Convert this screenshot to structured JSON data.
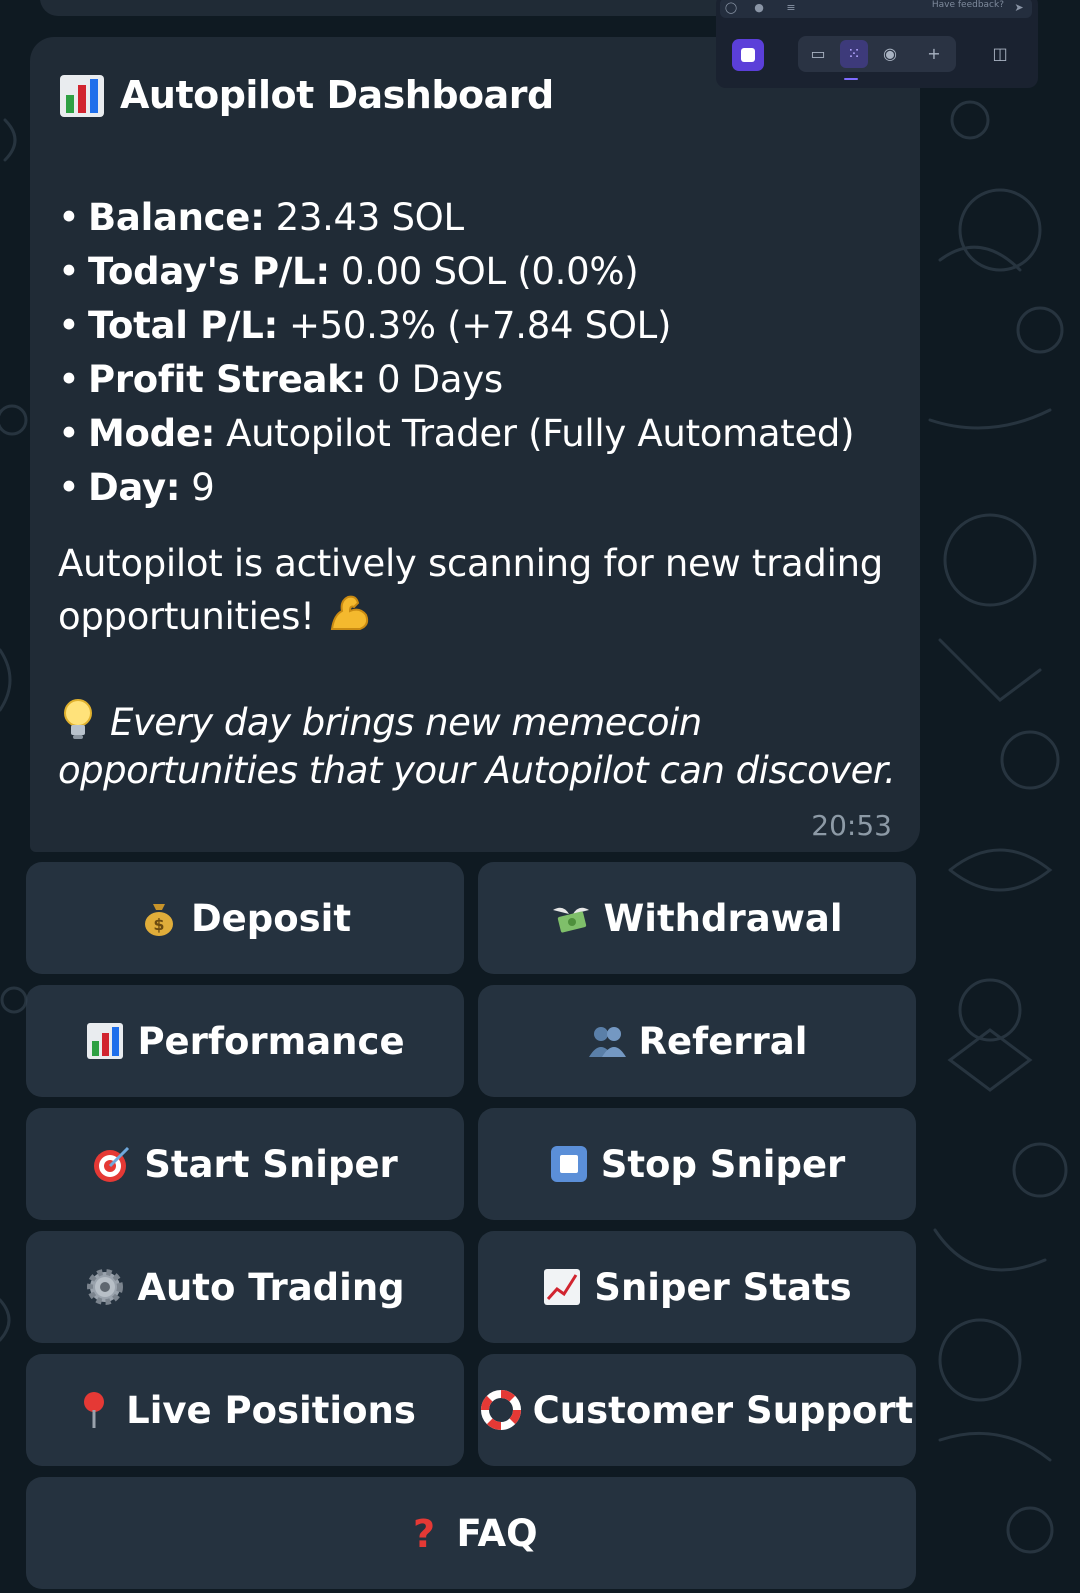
{
  "colors": {
    "background": "#0f1a22",
    "bubble": "#202b36",
    "button": "#2f3c49",
    "timestamp": "#8d9aa6",
    "accent": "#5b3fd9"
  },
  "overlay": {
    "feedback_text": "Have feedback?",
    "icons": [
      "paperclip-icon",
      "microphone-icon",
      "sliders-icon",
      "send-icon",
      "stop-recording-icon",
      "desktop-icon",
      "grid-icon",
      "globe-icon",
      "plus-icon",
      "side-panel-icon"
    ]
  },
  "message": {
    "title_icon": "bar-chart-icon",
    "title": "Autopilot Dashboard",
    "stats": [
      {
        "label": "Balance:",
        "value": "23.43 SOL"
      },
      {
        "label": "Today's P/L:",
        "value": "0.00 SOL (0.0%)"
      },
      {
        "label": "Total P/L:",
        "value": "+50.3% (+7.84 SOL)"
      },
      {
        "label": "Profit Streak:",
        "value": "0 Days"
      },
      {
        "label": "Mode:",
        "value": "Autopilot Trader (Fully Automated)"
      },
      {
        "label": "Day:",
        "value": "9"
      }
    ],
    "scan_text": "Autopilot is actively scanning for new trading opportunities!",
    "scan_icon": "flexed-bicep-icon",
    "tip_icon": "light-bulb-icon",
    "tip_text": "Every day brings new memecoin opportunities that your Autopilot can discover.",
    "time": "20:53"
  },
  "keyboard": {
    "buttons": [
      {
        "label": "Deposit",
        "icon": "money-bag-icon"
      },
      {
        "label": "Withdrawal",
        "icon": "money-with-wings-icon"
      },
      {
        "label": "Performance",
        "icon": "bar-chart-icon"
      },
      {
        "label": "Referral",
        "icon": "people-icon"
      },
      {
        "label": "Start Sniper",
        "icon": "target-icon"
      },
      {
        "label": "Stop Sniper",
        "icon": "stop-square-icon"
      },
      {
        "label": "Auto Trading",
        "icon": "gear-icon"
      },
      {
        "label": "Sniper Stats",
        "icon": "trending-up-chart-icon"
      },
      {
        "label": "Live Positions",
        "icon": "pin-icon"
      },
      {
        "label": "Customer Support",
        "icon": "life-ring-icon"
      },
      {
        "label": "FAQ",
        "icon": "question-mark-icon"
      }
    ]
  }
}
